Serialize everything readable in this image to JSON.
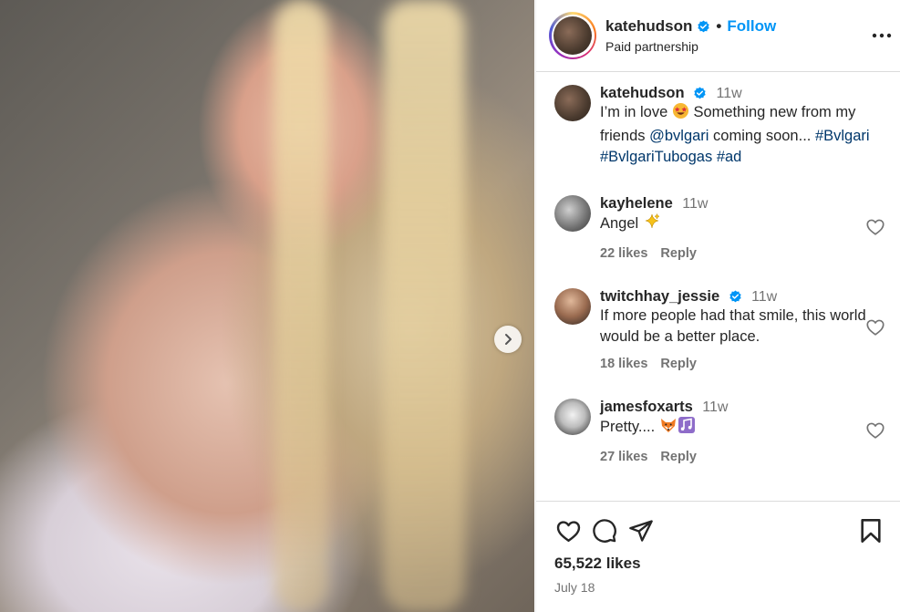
{
  "post": {
    "author": "katehudson",
    "verified": true,
    "follow_label": "Follow",
    "separator": "•",
    "subtitle": "Paid partnership",
    "caption": {
      "time": "11w",
      "text_1": "I’m in love ",
      "emoji": "star-struck",
      "text_2": " Something new from my friends ",
      "mention": "@bvlgari",
      "text_3": " coming soon... ",
      "tag_1": "#Bvlgari",
      "tag_2": "#BvlgariTubogas",
      "tag_3": "#ad"
    },
    "likes": "65,522 likes",
    "date": "July 18"
  },
  "comments": [
    {
      "username": "kayhelene",
      "verified": false,
      "time": "11w",
      "text": "Angel ",
      "emoji": "sparkles",
      "likes": "22 likes",
      "reply": "Reply"
    },
    {
      "username": "twitchhay_jessie",
      "verified": true,
      "time": "11w",
      "text": "If more people had that smile, this world would be a better place.",
      "likes": "18 likes",
      "reply": "Reply"
    },
    {
      "username": "jamesfoxarts",
      "verified": false,
      "time": "11w",
      "text": "Pretty.... ",
      "emoji": "fox, musical-notes",
      "likes": "27 likes",
      "reply": "Reply"
    }
  ],
  "colors": {
    "accent": "#0095f6",
    "link": "#00376b",
    "muted": "#737373",
    "text": "#262626"
  },
  "icons": [
    "more-options-icon",
    "verified-icon",
    "heart-icon",
    "comment-icon",
    "share-icon",
    "bookmark-icon",
    "chevron-right-icon"
  ]
}
